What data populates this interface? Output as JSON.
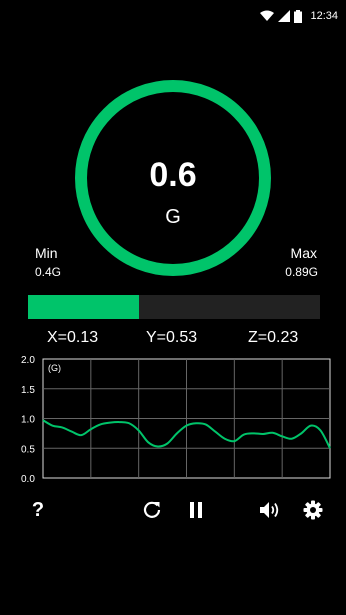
{
  "status_bar": {
    "time": "12:34"
  },
  "gauge": {
    "value": "0.6",
    "unit": "G",
    "ring_color": "#00c46a"
  },
  "min": {
    "label": "Min",
    "value": "0.4G"
  },
  "max": {
    "label": "Max",
    "value": "0.89G"
  },
  "level": {
    "fraction": 0.38
  },
  "axes": {
    "x": "X=0.13",
    "y": "Y=0.53",
    "z": "Z=0.23"
  },
  "chart_data": {
    "type": "line",
    "title": "",
    "unit_label": "(G)",
    "ylim": [
      0,
      2.0
    ],
    "y_ticks": [
      "2.0",
      "1.5",
      "1.0",
      "0.5",
      "0.0"
    ],
    "grid": true,
    "series": [
      {
        "values": [
          0.97,
          0.88,
          0.85,
          0.78,
          0.72,
          0.82,
          0.9,
          0.93,
          0.94,
          0.92,
          0.8,
          0.6,
          0.53,
          0.58,
          0.75,
          0.88,
          0.92,
          0.9,
          0.78,
          0.66,
          0.62,
          0.73,
          0.75,
          0.74,
          0.76,
          0.7,
          0.66,
          0.75,
          0.88,
          0.8,
          0.5
        ]
      }
    ],
    "line_color": "#00c46a"
  },
  "toolbar": {
    "help": "?",
    "icons": [
      "help-icon",
      "reset-icon",
      "pause-icon",
      "volume-icon",
      "settings-icon"
    ]
  }
}
